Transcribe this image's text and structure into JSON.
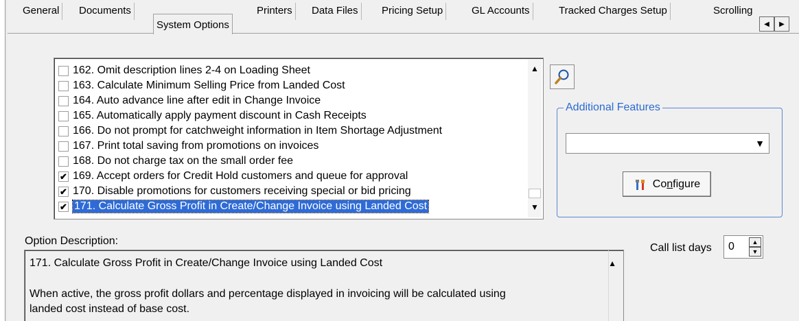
{
  "tabs": [
    {
      "label": "General",
      "active": false
    },
    {
      "label": "Documents",
      "active": false
    },
    {
      "label": "System Options",
      "active": true
    },
    {
      "label": "Printers",
      "active": false
    },
    {
      "label": "Data Files",
      "active": false
    },
    {
      "label": "Pricing Setup",
      "active": false
    },
    {
      "label": "GL Accounts",
      "active": false
    },
    {
      "label": "Tracked Charges Setup",
      "active": false
    },
    {
      "label": "Scrolling",
      "active": false
    }
  ],
  "options": [
    {
      "label": "162. Omit description lines 2-4 on Loading Sheet",
      "checked": false
    },
    {
      "label": "163. Calculate Minimum Selling Price from Landed Cost",
      "checked": false
    },
    {
      "label": "164. Auto advance line after edit in Change Invoice",
      "checked": false
    },
    {
      "label": "165. Automatically apply payment discount in Cash Receipts",
      "checked": false
    },
    {
      "label": "166. Do not prompt for catchweight information in Item Shortage Adjustment",
      "checked": false
    },
    {
      "label": "167. Print total saving from promotions on invoices",
      "checked": false
    },
    {
      "label": "168. Do not charge tax on the small order fee",
      "checked": false
    },
    {
      "label": "169. Accept orders for Credit Hold customers and queue for approval",
      "checked": true
    },
    {
      "label": "170. Disable promotions for customers receiving special or bid pricing",
      "checked": true
    },
    {
      "label": "171. Calculate Gross Profit in Create/Change Invoice using Landed Cost",
      "checked": true,
      "selected": true
    }
  ],
  "additional_features": {
    "title": "Additional Features",
    "selected_value": "",
    "configure_prefix": "Co",
    "configure_underlined": "n",
    "configure_suffix": "figure"
  },
  "option_description": {
    "label": "Option Description:",
    "lines": [
      "171. Calculate Gross Profit in Create/Change Invoice using Landed Cost",
      "",
      "When active, the gross profit dollars and percentage displayed in invoicing will be calculated using",
      "landed cost instead of base cost."
    ]
  },
  "call_list": {
    "label": "Call list days",
    "value": "0"
  },
  "icons": {
    "search": "magnifier-icon",
    "configure": "tools-icon"
  },
  "colors": {
    "selection": "#2e6bd6",
    "group_border": "#5b86d6",
    "group_title": "#2a6ad2"
  }
}
